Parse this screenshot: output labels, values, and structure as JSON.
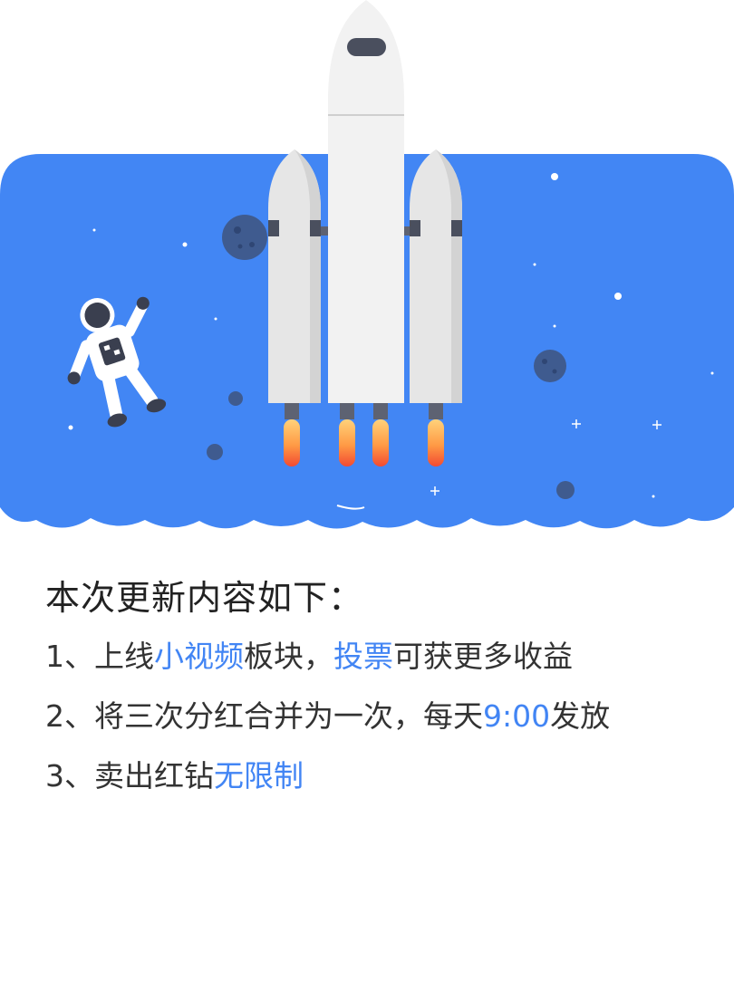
{
  "title": "本次更新内容如下：",
  "items": [
    {
      "parts": [
        {
          "t": "1、上线",
          "hl": false
        },
        {
          "t": "小视频",
          "hl": true
        },
        {
          "t": "板块，",
          "hl": false
        },
        {
          "t": "投票",
          "hl": true
        },
        {
          "t": "可获更多收益",
          "hl": false
        }
      ]
    },
    {
      "parts": [
        {
          "t": "2、将三次分红合并为一次，每天",
          "hl": false
        },
        {
          "t": "9:00",
          "hl": true
        },
        {
          "t": "发放",
          "hl": false
        }
      ]
    },
    {
      "parts": [
        {
          "t": "3、卖出红钻",
          "hl": false
        },
        {
          "t": "无限制",
          "hl": true
        }
      ]
    }
  ],
  "colors": {
    "sky": "#4286f4",
    "text": "#333333",
    "highlight": "#4285f4",
    "rocket": "#eeeeee",
    "flame": "#f45a3b"
  },
  "icons": [
    "rocket-illustration",
    "astronaut-illustration",
    "planet-icon",
    "star-icon"
  ]
}
